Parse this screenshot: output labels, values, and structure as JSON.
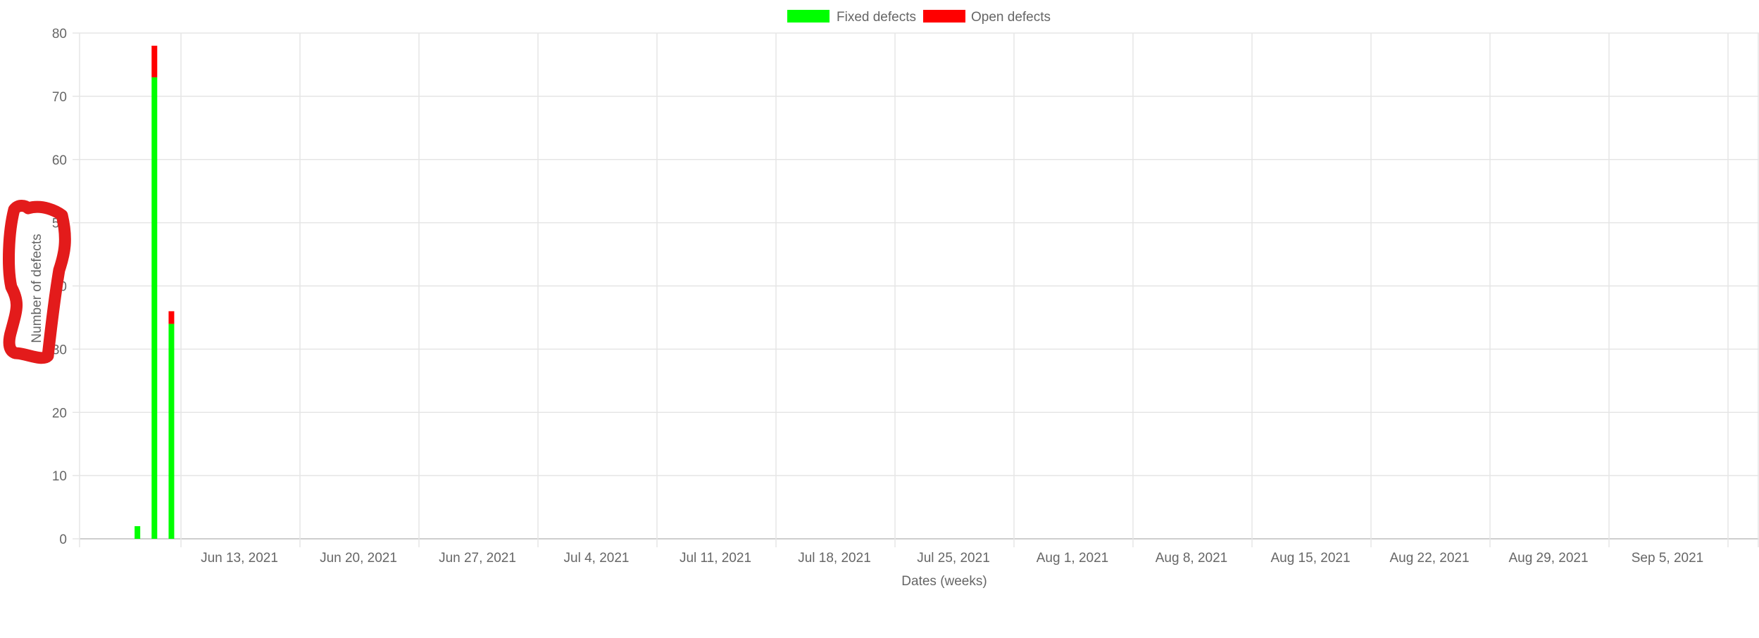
{
  "chart_data": {
    "type": "bar",
    "stacked": true,
    "xlabel": "Dates (weeks)",
    "ylabel": "Number of defects",
    "ylim": [
      0,
      80
    ],
    "yticks": [
      0,
      10,
      20,
      30,
      40,
      50,
      60,
      70,
      80
    ],
    "x_tick_labels": [
      "Jun 13, 2021",
      "Jun 20, 2021",
      "Jun 27, 2021",
      "Jul 4, 2021",
      "Jul 11, 2021",
      "Jul 18, 2021",
      "Jul 25, 2021",
      "Aug 1, 2021",
      "Aug 8, 2021",
      "Aug 15, 2021",
      "Aug 22, 2021",
      "Aug 29, 2021",
      "Sep 5, 2021"
    ],
    "x_range": [
      "2021-06-02",
      "2021-09-10"
    ],
    "grid": true,
    "legend_position": "top",
    "series": [
      {
        "name": "Fixed defects",
        "color": "#00ff00",
        "points": [
          {
            "x": "2021-06-07",
            "y": 2
          },
          {
            "x": "2021-06-08",
            "y": 73
          },
          {
            "x": "2021-06-09",
            "y": 34
          }
        ]
      },
      {
        "name": "Open defects",
        "color": "#ff0000",
        "points": [
          {
            "x": "2021-06-07",
            "y": 0
          },
          {
            "x": "2021-06-08",
            "y": 5
          },
          {
            "x": "2021-06-09",
            "y": 2
          }
        ]
      }
    ]
  },
  "annotation": {
    "color": "#e31b1b",
    "target": "y-axis-title"
  }
}
